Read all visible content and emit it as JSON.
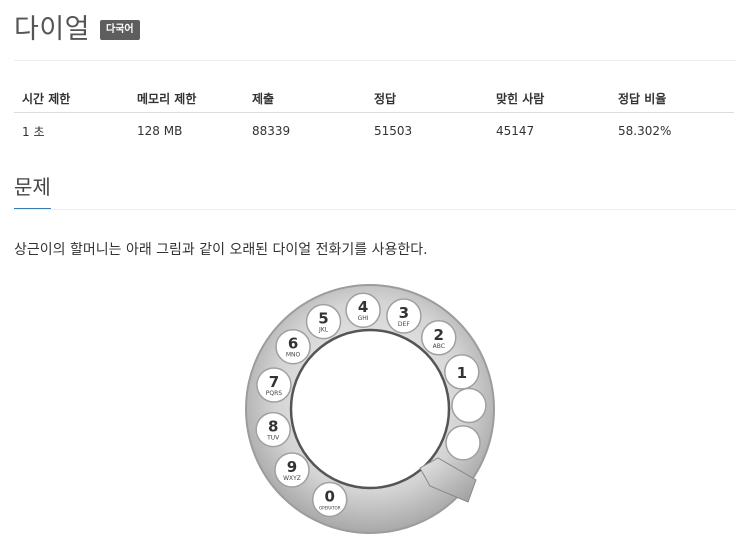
{
  "problem": {
    "title": "다이얼",
    "badge": "다국어"
  },
  "stats": {
    "headers": [
      "시간 제한",
      "메모리 제한",
      "제출",
      "정답",
      "맞힌 사람",
      "정답 비율"
    ],
    "values": [
      "1 초",
      "128 MB",
      "88339",
      "51503",
      "45147",
      "58.302%"
    ]
  },
  "section": {
    "title": "문제",
    "description": "상근이의 할머니는 아래 그림과 같이 오래된 다이얼 전화기를 사용한다."
  },
  "dial": {
    "holes": [
      {
        "digit": "1",
        "letters": ""
      },
      {
        "digit": "2",
        "letters": "ABC"
      },
      {
        "digit": "3",
        "letters": "DEF"
      },
      {
        "digit": "4",
        "letters": "GHI"
      },
      {
        "digit": "5",
        "letters": "JKL"
      },
      {
        "digit": "6",
        "letters": "MNO"
      },
      {
        "digit": "7",
        "letters": "PQRS"
      },
      {
        "digit": "8",
        "letters": "TUV"
      },
      {
        "digit": "9",
        "letters": "WXYZ"
      },
      {
        "digit": "0",
        "letters": "OPERATOR"
      }
    ]
  }
}
